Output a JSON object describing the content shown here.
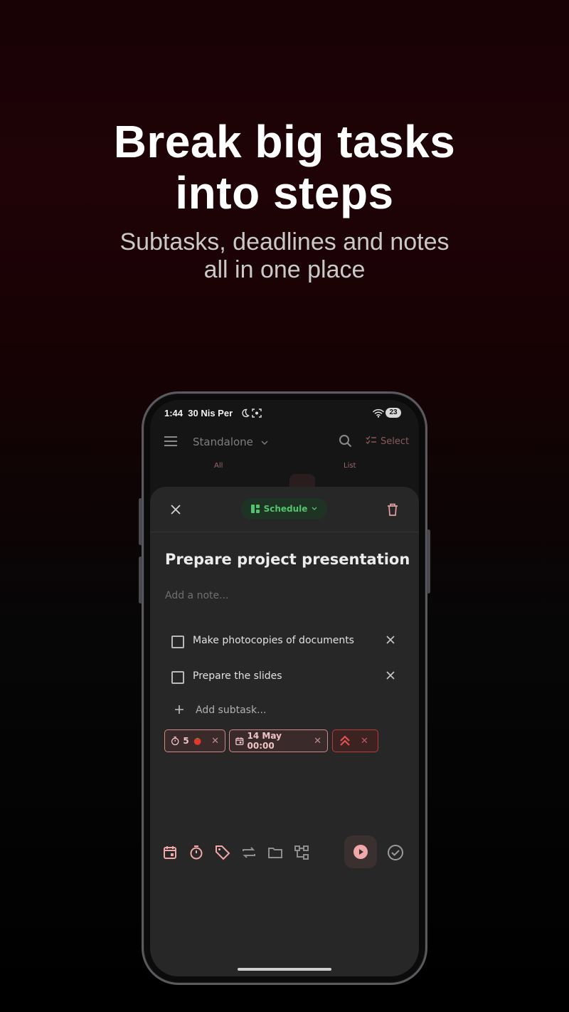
{
  "headline": {
    "title_line1": "Break big tasks",
    "title_line2": "into steps",
    "subtitle_line1": "Subtasks, deadlines and notes",
    "subtitle_line2": "all in one place"
  },
  "status_bar": {
    "time": "1:44",
    "date": "30 Nis Per",
    "battery": "23"
  },
  "app_bar": {
    "title": "Standalone",
    "select_label": "Select"
  },
  "view_tabs": {
    "left_label": "All",
    "right_label": "List"
  },
  "sheet": {
    "schedule_label": "Schedule",
    "task_title": "Prepare project presentation",
    "note_placeholder": "Add a note...",
    "subtasks": [
      {
        "label": "Make photocopies of documents",
        "checked": false
      },
      {
        "label": "Prepare the slides",
        "checked": false
      }
    ],
    "add_subtask_label": "Add subtask...",
    "chips": {
      "pomodoro_count": "5",
      "deadline": "14 May 00:00",
      "priority_icon": "double-chevron-up-icon"
    }
  },
  "colors": {
    "accent_pink": "#f0a8a8",
    "priority_red": "#e25050",
    "schedule_green": "#54c46c",
    "sheet_bg": "#272727"
  },
  "toolbar_icons": [
    "calendar-icon",
    "timer-icon",
    "tag-icon",
    "repeat-icon",
    "folder-icon",
    "hierarchy-icon",
    "play-icon",
    "check-circle-icon"
  ]
}
